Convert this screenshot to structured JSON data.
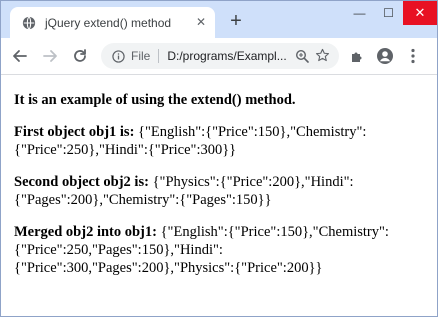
{
  "browser": {
    "tab_title": "jQuery extend() method",
    "new_tab_symbol": "+",
    "close_symbol": "✕",
    "omnibox_scheme_label": "File",
    "url": "D:/programs/Exampl..."
  },
  "window_controls": {
    "minimize": "—",
    "maximize": "☐",
    "close": "✕"
  },
  "page": {
    "heading": "It is an example of using the extend() method.",
    "obj1_label": "First object obj1 is:",
    "obj1_value": "{\"English\":{\"Price\":150},\"Chemistry\":{\"Price\":250},\"Hindi\":{\"Price\":300}}",
    "obj2_label": "Second object obj2 is:",
    "obj2_value": "{\"Physics\":{\"Price\":200},\"Hindi\":{\"Pages\":200},\"Chemistry\":{\"Pages\":150}}",
    "merged_label": "Merged obj2 into obj1:",
    "merged_value": "{\"English\":{\"Price\":150},\"Chemistry\":{\"Price\":250,\"Pages\":150},\"Hindi\":{\"Price\":300,\"Pages\":200},\"Physics\":{\"Price\":200}}"
  },
  "colors": {
    "tabstrip": "#cfe0fa",
    "close_button": "#e81123"
  }
}
